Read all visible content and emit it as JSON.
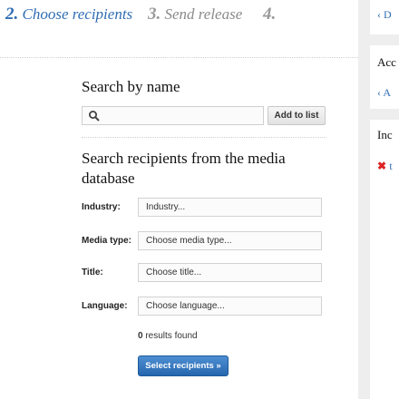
{
  "steps": [
    {
      "num": "2.",
      "label": "Choose recipients"
    },
    {
      "num": "3.",
      "label": "Send release"
    },
    {
      "num": "4.",
      "label": ""
    }
  ],
  "search_by_name": {
    "title": "Search by name",
    "placeholder": "",
    "add_button": "Add to list"
  },
  "media_search": {
    "title": "Search recipients from the media database",
    "fields": [
      {
        "label": "Industry:",
        "value": "Industry..."
      },
      {
        "label": "Media type:",
        "value": "Choose media type..."
      },
      {
        "label": "Title:",
        "value": "Choose title..."
      },
      {
        "label": "Language:",
        "value": "Choose language..."
      }
    ],
    "results_count": "0",
    "results_text": " results found",
    "submit_button": "Select recipients »"
  },
  "sidebar": {
    "link1": "‹ D",
    "header1": "Acc",
    "link2": "‹ A",
    "header2": "Inc",
    "item": "t"
  },
  "colors": {
    "accent": "#2f6db4",
    "button_primary": "#2566ad",
    "error_x": "#dd2222"
  }
}
